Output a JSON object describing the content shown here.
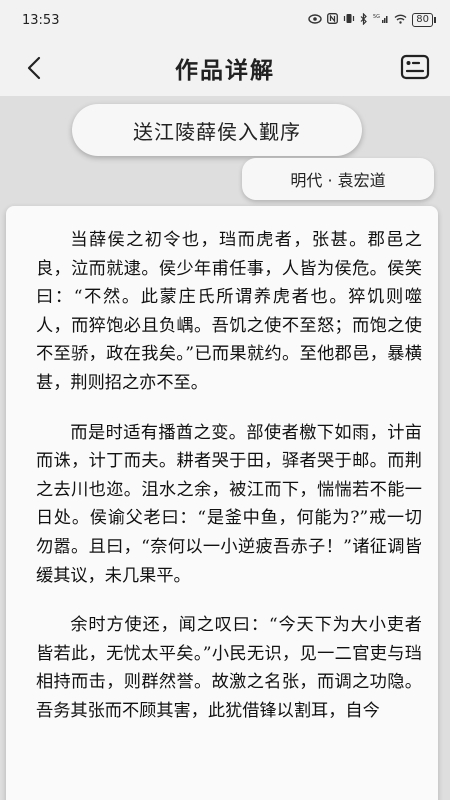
{
  "status": {
    "time": "13:53",
    "battery": "80",
    "signal": "5G"
  },
  "header": {
    "title": "作品详解"
  },
  "work": {
    "title": "送江陵薛侯入觐序",
    "author": "明代 · 袁宏道"
  },
  "content": {
    "paragraphs": [
      "当薛侯之初令也，珰而虎者，张甚。郡邑之良，泣而就逮。侯少年甫任事，人皆为侯危。侯笑曰：“不然。此蒙庄氏所谓养虎者也。猝饥则噬人，而猝饱必且负嵎。吾饥之使不至怒；而饱之使不至骄，政在我矣。”已而果就约。至他郡邑，暴横甚，荆则招之亦不至。",
      "而是时适有播酋之变。部使者檄下如雨，计亩而诛，计丁而夫。耕者哭于田，驿者哭于邮。而荆之去川也迩。沮水之余，被江而下，惴惴若不能一日处。侯谕父老曰：“是釜中鱼，何能为?”戒一切勿嚣。且曰，“奈何以一小逆疲吾赤子！”诸征调皆缓其议，未几果平。",
      "余时方使还，闻之叹曰：“今天下为大小吏者皆若此，无忧太平矣。”小民无识，见一二官吏与珰相持而击，则群然誉。故激之名张，而调之功隐。吾务其张而不顾其害，此犹借锋以割耳，自今"
    ]
  }
}
